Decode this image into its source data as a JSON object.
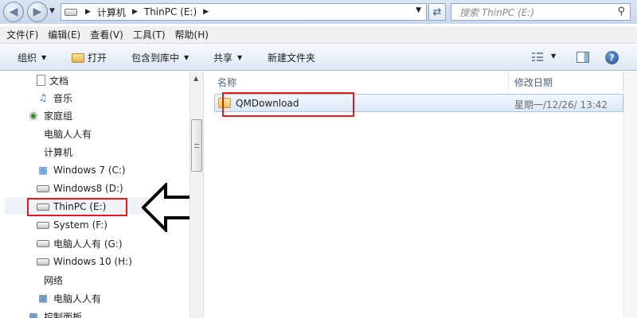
{
  "address_bar": {
    "crumbs": [
      "计算机",
      "ThinPC (E:)"
    ],
    "search_placeholder": "搜索 ThinPC (E:)"
  },
  "menu": [
    "文件(F)",
    "编辑(E)",
    "查看(V)",
    "工具(T)",
    "帮助(H)"
  ],
  "toolbar": {
    "organize": "组织",
    "open": "打开",
    "include_in_library": "包含到库中",
    "share": "共享",
    "new_folder": "新建文件夹"
  },
  "tree": {
    "items": [
      {
        "label": "文档",
        "icon": "document-icon"
      },
      {
        "label": "音乐",
        "icon": "music-icon"
      },
      {
        "label": "家庭组",
        "icon": "homegroup-icon"
      },
      {
        "label": "电脑人人有",
        "icon": "user-icon"
      },
      {
        "label": "计算机",
        "icon": "computer-icon"
      },
      {
        "label": "Windows 7  (C:)",
        "icon": "system-drive-icon"
      },
      {
        "label": "Windows8 (D:)",
        "icon": "drive-icon"
      },
      {
        "label": "ThinPC (E:)",
        "icon": "drive-icon",
        "selected": true
      },
      {
        "label": "System (F:)",
        "icon": "drive-icon"
      },
      {
        "label": "电脑人人有 (G:)",
        "icon": "drive-icon"
      },
      {
        "label": "Windows 10 (H:)",
        "icon": "drive-icon"
      },
      {
        "label": "网络",
        "icon": "network-icon"
      },
      {
        "label": "电脑人人有",
        "icon": "network-computer-icon"
      },
      {
        "label": "控制面板",
        "icon": "control-panel-icon"
      }
    ]
  },
  "file_list": {
    "columns": [
      "名称",
      "修改日期"
    ],
    "rows": [
      {
        "name": "QMDownload",
        "modified": "星期一/12/26/ 13:42",
        "icon": "folder-icon"
      }
    ]
  },
  "colors": {
    "highlight_red": "#e01c1c",
    "selection_blue": "#dbe8f8",
    "toolbar_blue": "#dde8f4"
  }
}
